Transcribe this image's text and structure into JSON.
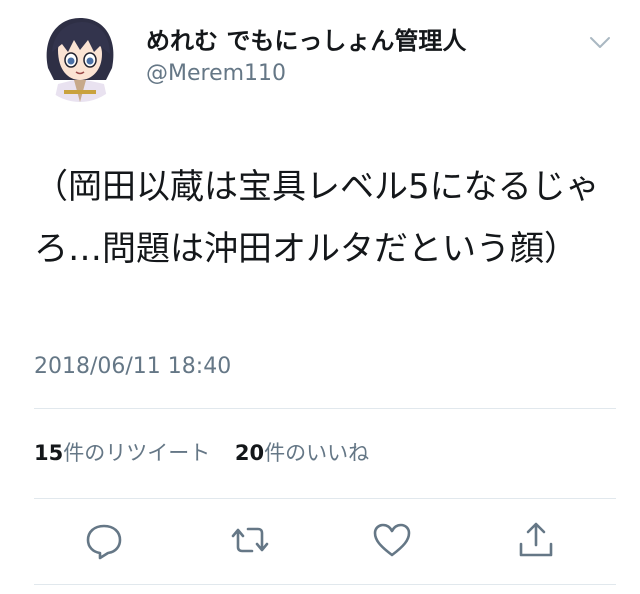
{
  "user": {
    "display_name": "めれむ でもにっしょん管理人",
    "handle": "@Merem110",
    "avatar_icon": "anime-character-avatar-icon"
  },
  "tweet": {
    "text": "（岡田以蔵は宝具レベル5になるじゃろ…問題は沖田オルタだという顔）",
    "timestamp": "2018/06/11 18:40"
  },
  "stats": {
    "retweet_count": "15",
    "retweet_label": "件のリツイート",
    "like_count": "20",
    "like_label": "件のいいね"
  },
  "actions": [
    {
      "name": "reply",
      "icon": "reply-icon"
    },
    {
      "name": "retweet",
      "icon": "retweet-icon"
    },
    {
      "name": "like",
      "icon": "heart-icon"
    },
    {
      "name": "share",
      "icon": "share-icon"
    }
  ],
  "colors": {
    "text_primary": "#14171a",
    "text_secondary": "#657786",
    "divider": "#e1e8ed",
    "icon": "#657786"
  }
}
